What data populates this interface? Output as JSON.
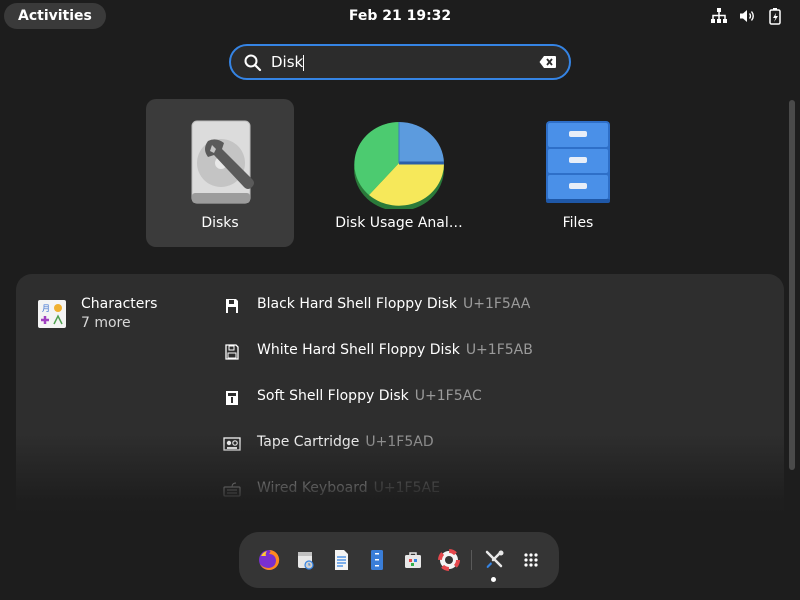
{
  "topbar": {
    "activities_label": "Activities",
    "clock": "Feb 21  19:32",
    "tray_icons": [
      "network-wired-icon",
      "volume-icon",
      "battery-icon"
    ]
  },
  "search": {
    "value": "Disk",
    "icons": [
      "search-icon",
      "clear-icon"
    ]
  },
  "apps": [
    {
      "label": "Disks",
      "icon": "disks-app-icon",
      "selected": true
    },
    {
      "label": "Disk Usage Anal…",
      "icon": "disk-usage-analyzer-icon",
      "selected": false
    },
    {
      "label": "Files",
      "icon": "files-app-icon",
      "selected": false
    }
  ],
  "characters": {
    "provider_name": "Characters",
    "more_label": "7 more",
    "results": [
      {
        "name": "Black Hard Shell Floppy Disk",
        "code": "U+1F5AA"
      },
      {
        "name": "White Hard Shell Floppy Disk",
        "code": "U+1F5AB"
      },
      {
        "name": "Soft Shell Floppy Disk",
        "code": "U+1F5AC"
      },
      {
        "name": "Tape Cartridge",
        "code": "U+1F5AD"
      },
      {
        "name": "Wired Keyboard",
        "code": "U+1F5AE"
      }
    ]
  },
  "dock": {
    "items": [
      "firefox-icon",
      "calendar-icon",
      "text-editor-icon",
      "files-icon",
      "software-icon",
      "help-icon",
      "tools-icon",
      "app-grid-icon"
    ]
  },
  "colors": {
    "accent": "#3584e4",
    "background": "#1d1d1d",
    "panel": "#2e2e2e"
  }
}
